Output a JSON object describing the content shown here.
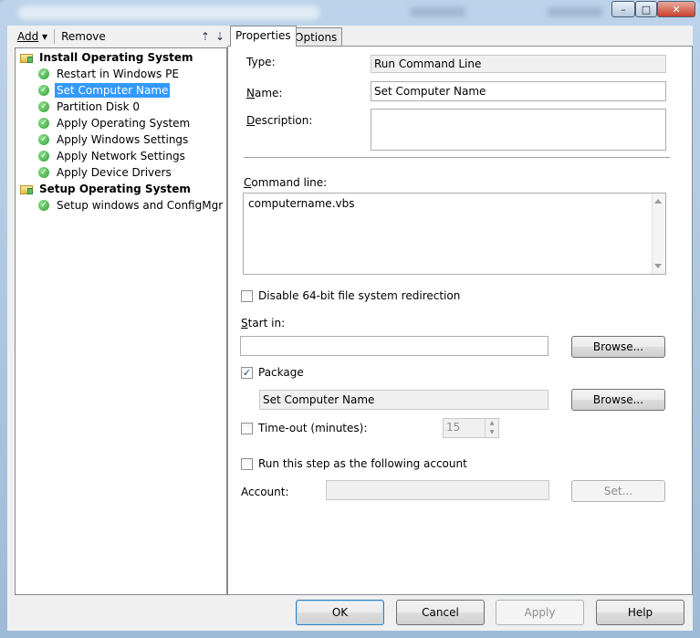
{
  "toolbar": {
    "add_label": "Add",
    "remove_label": "Remove"
  },
  "tree": [
    {
      "label": "Install Operating System",
      "type": "group"
    },
    {
      "label": "Restart in Windows PE",
      "type": "step"
    },
    {
      "label": "Set Computer Name",
      "type": "step",
      "selected": true
    },
    {
      "label": "Partition Disk 0",
      "type": "step"
    },
    {
      "label": "Apply Operating System",
      "type": "step"
    },
    {
      "label": "Apply Windows Settings",
      "type": "step"
    },
    {
      "label": "Apply Network Settings",
      "type": "step"
    },
    {
      "label": "Apply Device Drivers",
      "type": "step"
    },
    {
      "label": "Setup Operating System",
      "type": "group"
    },
    {
      "label": "Setup windows and ConfigMgr",
      "type": "step"
    }
  ],
  "tabs": {
    "properties": "Properties",
    "options": "Options"
  },
  "props": {
    "type_label": "Type:",
    "type_value": "Run Command Line",
    "name_label": "Name:",
    "name_value": "Set Computer Name",
    "description_label": "Description:",
    "description_value": "",
    "command_label": "Command line:",
    "command_value": "computername.vbs",
    "disable64_label": "Disable 64-bit file system redirection",
    "startin_label": "Start in:",
    "startin_value": "",
    "browse_label": "Browse...",
    "package_label": "Package",
    "package_value": "Set Computer Name",
    "timeout_label": "Time-out (minutes):",
    "timeout_value": "15",
    "runas_label": "Run this step as the following account",
    "account_label": "Account:",
    "account_value": "",
    "set_label": "Set..."
  },
  "buttons": {
    "ok": "OK",
    "cancel": "Cancel",
    "apply": "Apply",
    "help": "Help"
  },
  "window_controls": {
    "minimize": "–",
    "maximize": "□",
    "close": "✕"
  }
}
